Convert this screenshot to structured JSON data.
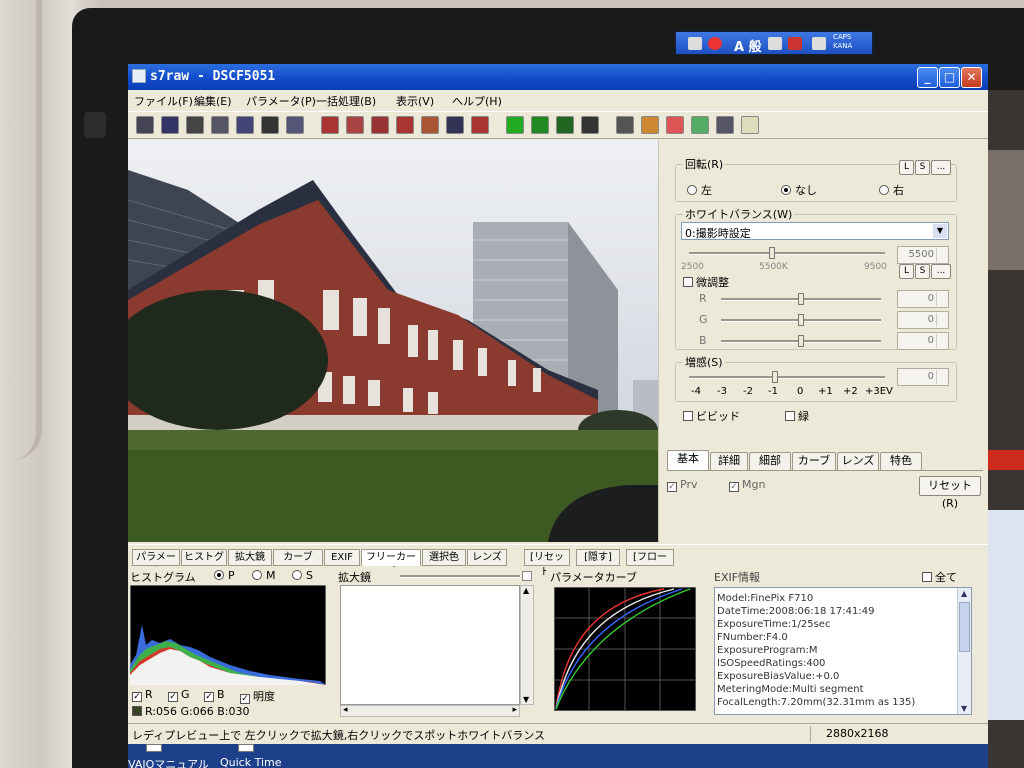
{
  "window": {
    "title": "s7raw - DSCF5051",
    "minimize_glyph": "_",
    "maximize_glyph": "□",
    "close_glyph": "✕"
  },
  "menu": [
    "ファイル(F)",
    "編集(E)",
    "パラメータ(P)",
    "一括処理(B)",
    "表示(V)",
    "ヘルプ(H)"
  ],
  "ime": {
    "mode": "A 般",
    "caps": "CAPS",
    "kana": "KANA"
  },
  "toolbar_icons": [
    "open-icon",
    "save-icon",
    "save-as-icon",
    "copy-icon",
    "zoom-icon",
    "crop-icon",
    "layers-icon",
    "convert-1-icon",
    "convert-2-icon",
    "convert-3-icon",
    "convert-4-icon",
    "convert-5-icon",
    "batch-1-icon",
    "batch-2-icon",
    "view-green-icon",
    "view-grid-icon",
    "view-split-icon",
    "view-prev-icon",
    "grid-icon",
    "palette-icon",
    "rgb-icon",
    "curve-icon",
    "level-icon",
    "help-icon"
  ],
  "right_panel": {
    "rotate": {
      "label": "回転(R)",
      "l": "L",
      "s": "S",
      "more": "...",
      "options": [
        "左",
        "なし",
        "右"
      ],
      "selected": 1
    },
    "wb": {
      "label": "ホワイトバランス(W)",
      "preset": "0:撮影時設定",
      "dropdown_glyph": "▼",
      "temp_value": "5500",
      "scale_min": "2500",
      "scale_mid": "5500K",
      "scale_max": "9500",
      "l": "L",
      "s": "S",
      "more": "...",
      "fine_label": "微調整",
      "fine_checked": false,
      "channels": [
        {
          "name": "R",
          "value": "0",
          "level": 0.5
        },
        {
          "name": "G",
          "value": "0",
          "level": 0.5
        },
        {
          "name": "B",
          "value": "0",
          "level": 0.5
        }
      ]
    },
    "sens": {
      "label": "増感(S)",
      "value": "0",
      "level": 0.44,
      "ticks": [
        "-4",
        "-3",
        "-2",
        "-1",
        "0",
        "+1",
        "+2",
        "+3EV"
      ]
    },
    "vivid": {
      "label": "ビビッド",
      "checked": false
    },
    "green": {
      "label": "緑",
      "checked": false
    },
    "tabs": [
      "基本",
      "詳細",
      "細部",
      "カーブ",
      "レンズ",
      "特色"
    ],
    "active_tab": 0,
    "prv": {
      "label": "Prv",
      "checked": true,
      "mark": "✓"
    },
    "mgn": {
      "label": "Mgn",
      "checked": true,
      "mark": "✓"
    },
    "reset_button": "リセット(R)"
  },
  "bottom_tabs": [
    "パラメータ",
    "ヒストグラム",
    "拡大鏡",
    "カーブ",
    "EXIF",
    "フリーカーブ",
    "選択色",
    "レンズ"
  ],
  "bottom_buttons": [
    "[リセット]",
    "[隠す]",
    "[フロート]"
  ],
  "histogram": {
    "title": "ヒストグラム",
    "modes": [
      "P",
      "M",
      "S"
    ],
    "selected_mode": 0,
    "channels": [
      {
        "label": "R",
        "checked": true
      },
      {
        "label": "G",
        "checked": true
      },
      {
        "label": "B",
        "checked": true
      },
      {
        "label": "明度",
        "checked": true
      }
    ],
    "check_mark": "✓",
    "readout": "R:056 G:066 B:030"
  },
  "magnifier": {
    "title": "拡大鏡",
    "arrow_up": "▲",
    "arrow_down": "▼",
    "arrow_left": "◂",
    "arrow_right": "▸"
  },
  "curve": {
    "title": "パラメータカーブ"
  },
  "exif": {
    "title": "EXIF情報",
    "all_label": "全て",
    "all_checked": false,
    "arrow_up": "▲",
    "arrow_down": "▼",
    "lines": [
      "Model:FinePix F710",
      "DateTime:2008:06:18 17:41:49",
      "ExposureTime:1/25sec",
      "FNumber:F4.0",
      "ExposureProgram:M",
      "ISOSpeedRatings:400",
      "ExposureBiasValue:+0.0",
      "MeteringMode:Multi segment",
      "FocalLength:7.20mm(32.31mm as 135)"
    ]
  },
  "status": {
    "hint": "レディプレビュー上で 左クリックで拡大鏡,右クリックでスポットホワイトバランス",
    "size": "2880x2168"
  },
  "desktop": {
    "icons": [
      "VAIOマニュアル",
      "Quick Time"
    ]
  }
}
